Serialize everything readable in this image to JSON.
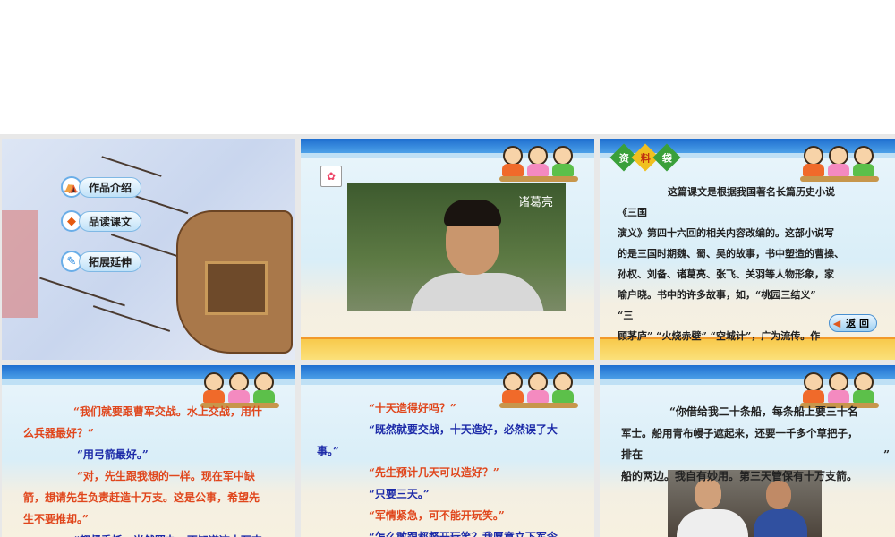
{
  "slides": [
    {
      "menu": [
        {
          "label": "作品介绍",
          "icon": "tent-icon"
        },
        {
          "label": "品读课文",
          "icon": "book-icon"
        },
        {
          "label": "拓展延伸",
          "icon": "pencil-icon"
        }
      ]
    },
    {
      "caption": "诸葛亮"
    },
    {
      "tag": [
        "资",
        "料",
        "袋"
      ],
      "back_label": "返 回",
      "lines": [
        "这篇课文是根据我国著名长篇历史小说",
        "《三国",
        "演义》第四十六回的相关内容改编的。这部小说写",
        "的是三国时期魏、蜀、吴的故事，书中塑造的曹操、",
        "孙权、刘备、诸葛亮、张飞、关羽等人物形象，家",
        "喻户晓。书中的许多故事，如，“桃园三结义”",
        "“三",
        "顾茅庐”  “火烧赤壁” “空城计”，广为流传。作"
      ]
    },
    {
      "lines": [
        "“我们就要跟曹军交战。水上交战，用什",
        "么兵器最好？”",
        "“用弓箭最好。”",
        "“对，先生跟我想的一样。现在军中缺",
        "箭，想请先生负责赶造十万支。这是公事，希望先",
        "生不要推却。”",
        "“都督委托，当然照办。不知道这十万支"
      ]
    },
    {
      "lines": [
        "“十天造得好吗？”",
        "“既然就要交战，十天造好，必然误了大",
        "事。”",
        "“先生预计几天可以造好？”",
        "“只要三天。”",
        "“军情紧急，可不能开玩笑。”",
        "“怎么敢跟都督开玩笑？我愿意立下军令"
      ]
    },
    {
      "lines": [
        "“你借给我二十条船，每条船上要三十名",
        "军士。船用青布幔子遮起来，还要一千多个草把子，",
        "排在",
        "”",
        "船的两边。我自有妙用。第三天管保有十万支箭。"
      ]
    }
  ],
  "colors": {
    "red": "#e0461c",
    "blue": "#1c2aa8"
  }
}
